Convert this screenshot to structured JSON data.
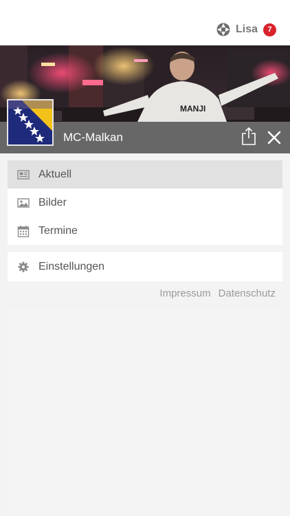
{
  "header": {
    "user_name": "Lisa",
    "notification_count": "7",
    "user_icon": "app-logo-icon",
    "badge_color": "#d9232d"
  },
  "profile": {
    "artist_name": "MC-Malkan",
    "share_icon": "share-icon",
    "close_icon": "close-icon"
  },
  "menu": {
    "items": [
      {
        "label": "Aktuell",
        "icon": "news-icon",
        "active": true
      },
      {
        "label": "Bilder",
        "icon": "image-icon",
        "active": false
      },
      {
        "label": "Termine",
        "icon": "calendar-icon",
        "active": false
      }
    ],
    "settings": {
      "label": "Einstellungen",
      "icon": "gear-icon"
    }
  },
  "footer": {
    "impressum": "Impressum",
    "datenschutz": "Datenschutz"
  }
}
